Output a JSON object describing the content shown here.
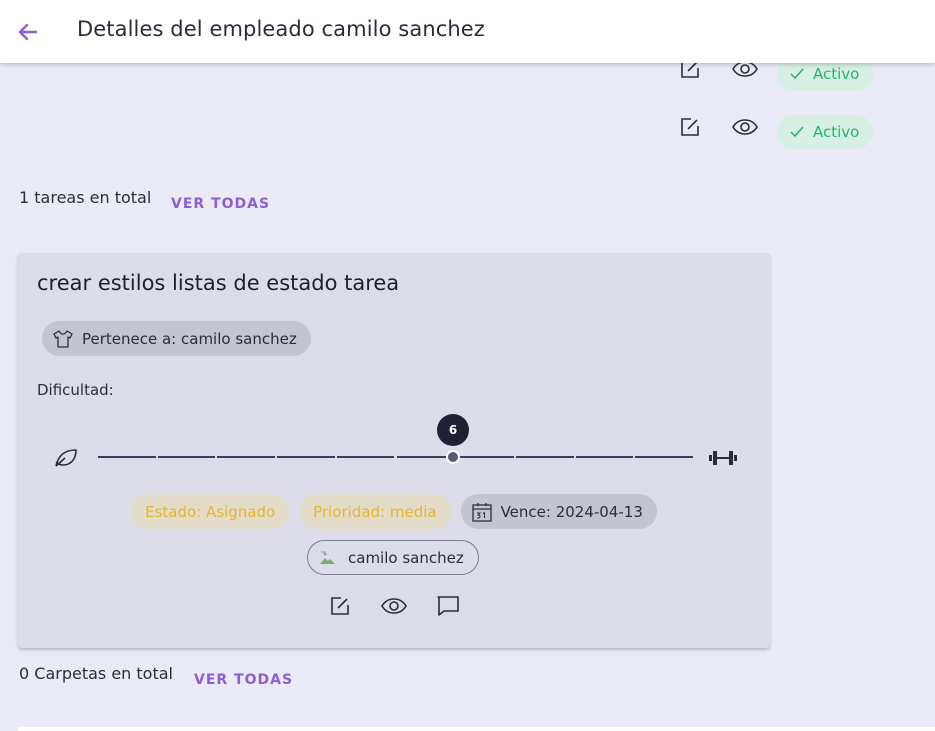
{
  "header": {
    "title": "Detalles del empleado camilo sanchez"
  },
  "status_rows": [
    {
      "status": "Activo"
    },
    {
      "status": "Activo"
    }
  ],
  "tasks_section": {
    "count_label": "1 tareas en total",
    "see_all": "VER TODAS"
  },
  "task": {
    "title": "crear estilos listas de estado tarea",
    "owner_label": "Pertenece a: camilo sanchez",
    "difficulty_label": "Dificultad:",
    "difficulty_value": "6",
    "difficulty_level": 6,
    "difficulty_max": 10,
    "state": "Estado: Asignado",
    "priority": "Prioridad: media",
    "due": "Vence: 2024-04-13",
    "assignee": "camilo sanchez",
    "icons": {
      "owner": "shirt-icon",
      "due": "calendar-icon",
      "difficulty_min": "leaf-icon",
      "difficulty_max": "dumbbell-icon"
    }
  },
  "folders_section": {
    "count_label": "0 Carpetas en total",
    "see_all": "VER TODAS"
  },
  "colors": {
    "accent": "#8b5fd4",
    "active_text": "#22b66b",
    "active_bg": "#d7efe4",
    "warning": "#e8b52a"
  }
}
